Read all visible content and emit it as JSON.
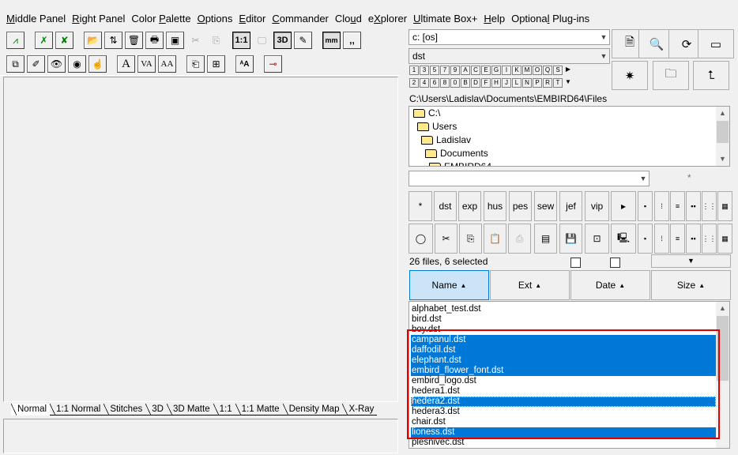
{
  "menu": [
    {
      "label": "Middle Panel",
      "ul": "M"
    },
    {
      "label": "Right Panel",
      "ul": "R"
    },
    {
      "label": "Color Palette",
      "ul": "P"
    },
    {
      "label": "Options",
      "ul": "O"
    },
    {
      "label": "Editor",
      "ul": "E"
    },
    {
      "label": "Commander",
      "ul": "C"
    },
    {
      "label": "Cloud",
      "ul": "u"
    },
    {
      "label": "eXplorer",
      "ul": "X"
    },
    {
      "label": "Ultimate Box+",
      "ul": "U"
    },
    {
      "label": "Help",
      "ul": "H"
    },
    {
      "label": "Optional Plug-ins",
      "ul": "l"
    }
  ],
  "toolbar1": {
    "one_to_one": "1:1",
    "three_d": "3D",
    "mm": "mm",
    "quote": ",,"
  },
  "toolbar2": {
    "text_a": "A",
    "text_va": "VA",
    "text_ab": "AA"
  },
  "view_tabs": [
    "Normal",
    "1:1 Normal",
    "Stitches",
    "3D",
    "3D Matte",
    "1:1",
    "1:1 Matte",
    "Density Map",
    "X-Ray"
  ],
  "drive_combo": "c: [os]",
  "filter_combo": "dst",
  "drive_row1": [
    "1",
    "3",
    "5",
    "7",
    "9",
    "A",
    "C",
    "E",
    "G",
    "I",
    "K",
    "M",
    "O",
    "Q",
    "S"
  ],
  "drive_row2": [
    "2",
    "4",
    "6",
    "8",
    "0",
    "B",
    "D",
    "F",
    "H",
    "J",
    "L",
    "N",
    "P",
    "R",
    "T"
  ],
  "current_path": "C:\\Users\\Ladislav\\Documents\\EMBIRD64\\Files",
  "tree": [
    "C:\\",
    "Users",
    "Ladislav",
    "Documents",
    "EMBIRD64"
  ],
  "search_star": "*",
  "format_buttons": [
    "*",
    "dst",
    "exp",
    "hus",
    "pes",
    "sew",
    "jef",
    "vip"
  ],
  "file_count": "26 files, 6 selected",
  "sort": {
    "name": "Name",
    "ext": "Ext",
    "date": "Date",
    "size": "Size"
  },
  "files": [
    {
      "name": "alphabet_test.dst",
      "selected": false
    },
    {
      "name": "bird.dst",
      "selected": false
    },
    {
      "name": "boy.dst",
      "selected": false
    },
    {
      "name": "campanul.dst",
      "selected": true
    },
    {
      "name": "daffodil.dst",
      "selected": true
    },
    {
      "name": "elephant.dst",
      "selected": true
    },
    {
      "name": "embird_flower_font.dst",
      "selected": true
    },
    {
      "name": "embird_logo.dst",
      "selected": false
    },
    {
      "name": "hedera1.dst",
      "selected": false
    },
    {
      "name": "hedera2.dst",
      "selected": true
    },
    {
      "name": "hedera3.dst",
      "selected": false
    },
    {
      "name": "chair.dst",
      "selected": false
    },
    {
      "name": "lioness.dst",
      "selected": true
    },
    {
      "name": "plesnivec.dst",
      "selected": false
    }
  ],
  "colors": {
    "selection": "#0078d7",
    "highlight_box": "#e00000"
  }
}
